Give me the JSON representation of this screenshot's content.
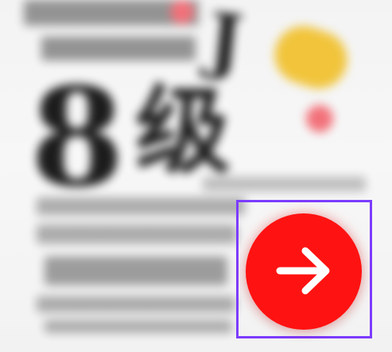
{
  "background": {
    "poster": {
      "big_number": "8",
      "big_char": "级",
      "corner_letter": "J"
    }
  },
  "colors": {
    "accent_selection": "#7c3cff",
    "button_red": "#ff1212",
    "arrow_white": "#ffffff"
  },
  "controls": {
    "next_button_icon": "arrow-right-icon"
  }
}
